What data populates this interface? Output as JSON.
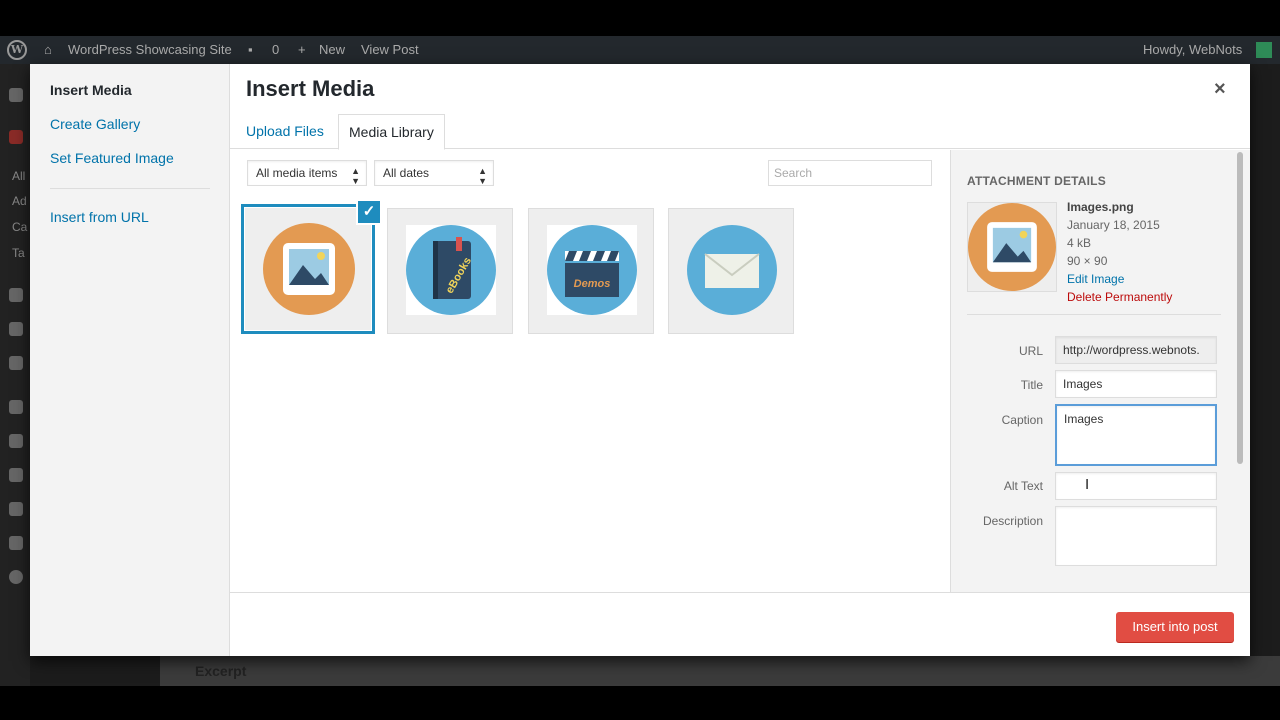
{
  "admin_bar": {
    "site_name": "WordPress Showcasing Site",
    "comments_count": "0",
    "new_label": "New",
    "view_post_label": "View Post",
    "greeting": "Howdy, WebNots"
  },
  "side_menu_fragments": [
    "All",
    "Ad",
    "Ca",
    "Ta"
  ],
  "page_section": {
    "excerpt_label": "Excerpt"
  },
  "modal": {
    "title": "Insert Media",
    "close_glyph": "×",
    "menu": {
      "items": [
        {
          "label": "Insert Media",
          "active": true
        },
        {
          "label": "Create Gallery",
          "active": false
        },
        {
          "label": "Set Featured Image",
          "active": false
        },
        {
          "label": "Insert from URL",
          "active": false
        }
      ]
    },
    "tabs": [
      {
        "label": "Upload Files",
        "active": false
      },
      {
        "label": "Media Library",
        "active": true
      }
    ],
    "filters": {
      "type_selected": "All media items",
      "date_selected": "All dates",
      "search_placeholder": "Search"
    },
    "attachments": [
      {
        "icon": "image-icon",
        "selected": true,
        "check_glyph": "✓",
        "circle_color": "#e39a52"
      },
      {
        "icon": "ebook-icon",
        "selected": false,
        "label": "eBooks",
        "circle_color": "#5aaed8"
      },
      {
        "icon": "clapperboard-icon",
        "selected": false,
        "label": "Demos",
        "circle_color": "#5aaed8"
      },
      {
        "icon": "envelope-icon",
        "selected": false,
        "circle_color": "#5aaed8"
      }
    ],
    "details": {
      "heading": "ATTACHMENT DETAILS",
      "filename": "Images.png",
      "date": "January 18, 2015",
      "size": "4 kB",
      "dimensions": "90 × 90",
      "edit_label": "Edit Image",
      "delete_label": "Delete Permanently",
      "fields": {
        "url_label": "URL",
        "url_value": "http://wordpress.webnots.",
        "title_label": "Title",
        "title_value": "Images",
        "caption_label": "Caption",
        "caption_value": "Images",
        "alt_label": "Alt Text",
        "alt_value": "",
        "description_label": "Description",
        "description_value": ""
      }
    },
    "toolbar": {
      "insert_label": "Insert into post"
    }
  },
  "colors": {
    "link": "#0073aa",
    "primary_button": "#e14d43",
    "selection": "#1e8cbe",
    "delete": "#bc0b0b"
  }
}
